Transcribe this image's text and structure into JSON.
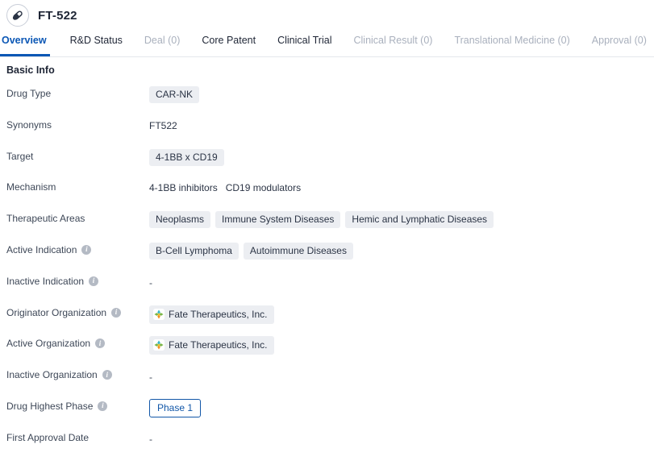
{
  "header": {
    "icon": "pill-capsule-icon",
    "title": "FT-522"
  },
  "tabs": [
    {
      "label": "Overview",
      "state": "active"
    },
    {
      "label": "R&D Status",
      "state": "enabled"
    },
    {
      "label": "Deal (0)",
      "state": "disabled"
    },
    {
      "label": "Core Patent",
      "state": "enabled"
    },
    {
      "label": "Clinical Trial",
      "state": "enabled"
    },
    {
      "label": "Clinical Result (0)",
      "state": "disabled"
    },
    {
      "label": "Translational Medicine (0)",
      "state": "disabled"
    },
    {
      "label": "Approval (0)",
      "state": "disabled"
    }
  ],
  "section": {
    "title": "Basic Info"
  },
  "info_icon_char": "i",
  "empty_value": "-",
  "rows": [
    {
      "label": "Drug Type",
      "has_info": false,
      "type": "chips",
      "values": [
        "CAR-NK"
      ]
    },
    {
      "label": "Synonyms",
      "has_info": false,
      "type": "text",
      "values": [
        "FT522"
      ]
    },
    {
      "label": "Target",
      "has_info": false,
      "type": "chips",
      "values": [
        "4-1BB x CD19"
      ]
    },
    {
      "label": "Mechanism",
      "has_info": false,
      "type": "text",
      "values": [
        "4-1BB inhibitors",
        "CD19 modulators"
      ]
    },
    {
      "label": "Therapeutic Areas",
      "has_info": false,
      "type": "chips",
      "values": [
        "Neoplasms",
        "Immune System Diseases",
        "Hemic and Lymphatic Diseases"
      ]
    },
    {
      "label": "Active Indication",
      "has_info": true,
      "type": "chips",
      "values": [
        "B-Cell Lymphoma",
        "Autoimmune Diseases"
      ]
    },
    {
      "label": "Inactive Indication",
      "has_info": true,
      "type": "empty",
      "values": []
    },
    {
      "label": "Originator Organization",
      "has_info": true,
      "type": "org-chips",
      "values": [
        "Fate Therapeutics, Inc."
      ]
    },
    {
      "label": "Active Organization",
      "has_info": true,
      "type": "org-chips",
      "values": [
        "Fate Therapeutics, Inc."
      ]
    },
    {
      "label": "Inactive Organization",
      "has_info": true,
      "type": "empty",
      "values": []
    },
    {
      "label": "Drug Highest Phase",
      "has_info": true,
      "type": "outline-chip",
      "values": [
        "Phase 1"
      ]
    },
    {
      "label": "First Approval Date",
      "has_info": false,
      "type": "empty",
      "values": []
    }
  ],
  "colors": {
    "accent": "#0b57b5",
    "chip_bg": "#eceef2",
    "text": "#2b3445",
    "muted": "#a9b0bd",
    "outline_chip": "#1257a8"
  }
}
